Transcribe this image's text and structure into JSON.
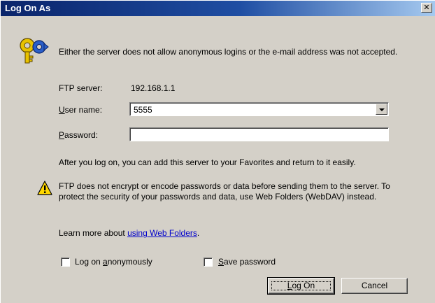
{
  "window": {
    "title": "Log On As",
    "close_glyph": "✕"
  },
  "message": "Either the server does not allow anonymous logins or the e-mail address was not accepted.",
  "ftp_server": {
    "label": "FTP server:",
    "value": "192.168.1.1"
  },
  "user_name": {
    "label_accesskey": "U",
    "label_rest": "ser name:",
    "value": "5555"
  },
  "password": {
    "label_accesskey": "P",
    "label_rest": "assword:",
    "value": ""
  },
  "favorites_note": "After you log on, you can add this server to your Favorites and return to it easily.",
  "warning": "FTP does not encrypt or encode passwords or data before sending them to the server.  To protect the security of your passwords and data, use Web Folders (WebDAV) instead.",
  "learn_more": {
    "prefix": "Learn more about ",
    "link_text": "using Web Folders",
    "suffix": "."
  },
  "checkboxes": {
    "anonymous": {
      "pre": "Log on ",
      "accesskey": "a",
      "post": "nonymously",
      "checked": false
    },
    "save_password": {
      "pre": "",
      "accesskey": "S",
      "post": "ave password",
      "checked": false
    }
  },
  "buttons": {
    "logon": {
      "accesskey": "L",
      "rest": "og On"
    },
    "cancel": {
      "label": "Cancel"
    }
  },
  "icons": {
    "key": "keys-icon",
    "warning": "warning-icon"
  },
  "colors": {
    "title_start": "#0a246a",
    "title_end": "#a6caf0",
    "link": "#0000cc",
    "warning_yellow": "#ffd700"
  }
}
